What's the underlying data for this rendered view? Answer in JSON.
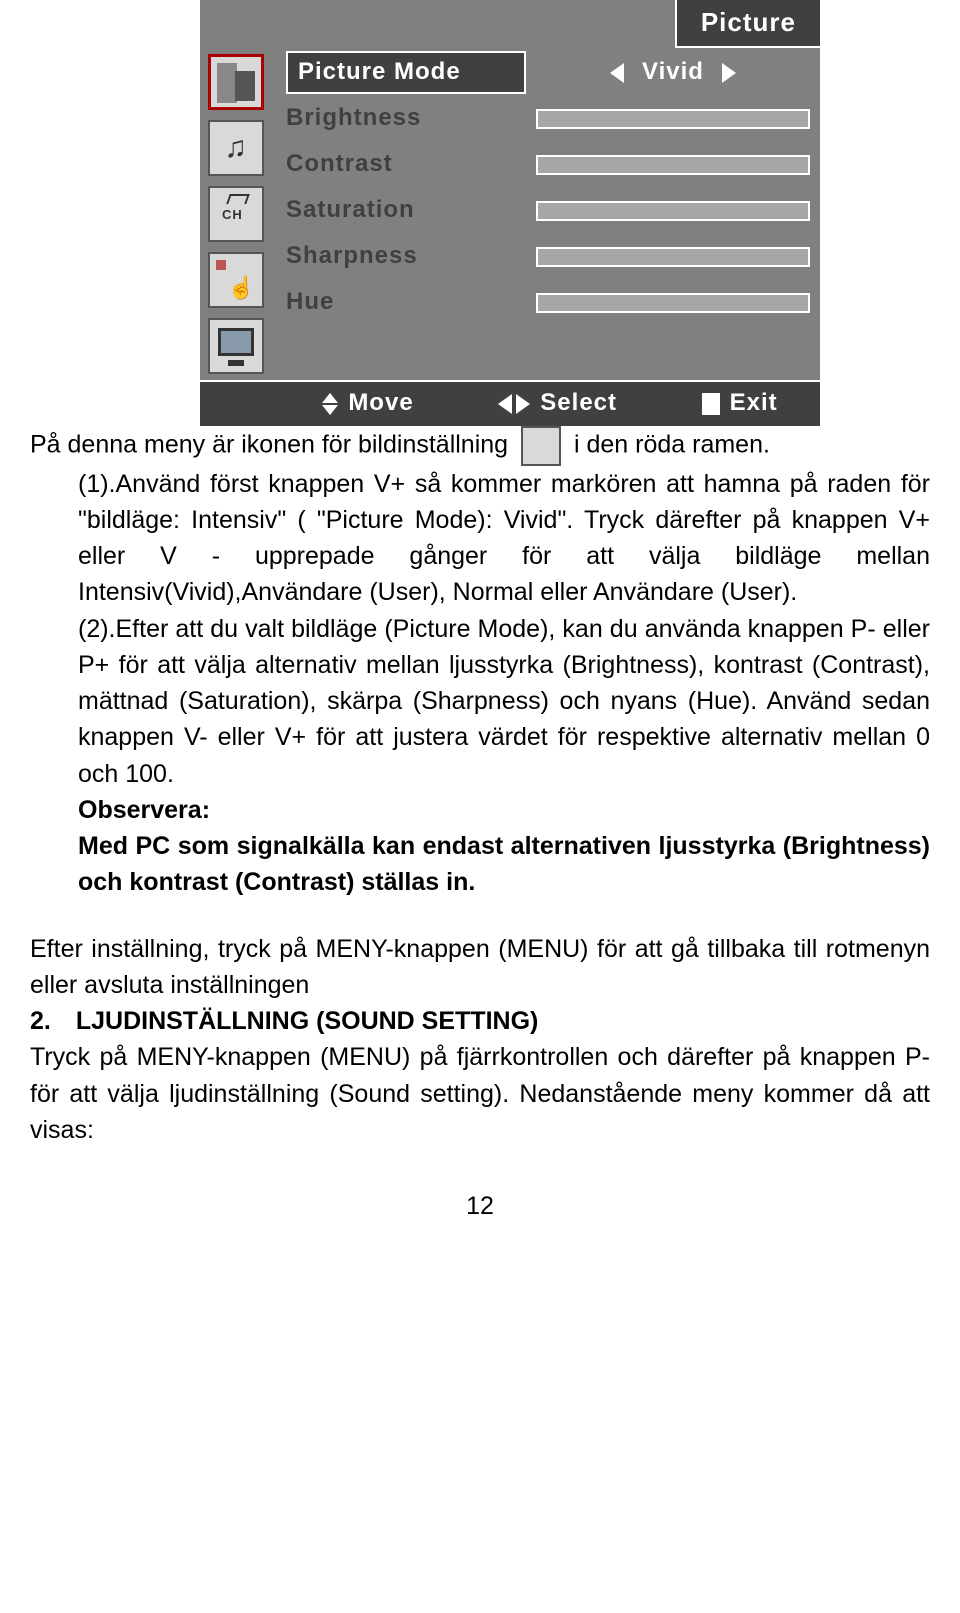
{
  "osd": {
    "title": "Picture",
    "rows": [
      {
        "label": "Picture Mode",
        "value": "Vivid",
        "type": "select",
        "active": true
      },
      {
        "label": "Brightness",
        "type": "bar"
      },
      {
        "label": "Contrast",
        "type": "bar"
      },
      {
        "label": "Saturation",
        "type": "bar"
      },
      {
        "label": "Sharpness",
        "type": "bar"
      },
      {
        "label": "Hue",
        "type": "bar"
      }
    ],
    "footer": {
      "move": "Move",
      "select": "Select",
      "exit": "Exit"
    }
  },
  "text": {
    "line1a": "På denna meny är ikonen för bildinställning",
    "line1b": "i den röda ramen.",
    "p1": "(1).Använd först knappen V+ så kommer markören att hamna på raden för \"bildläge: Intensiv\" ( \"Picture Mode): Vivid\". Tryck därefter på knappen V+ eller V - upprepade gånger för att välja bildläge mellan Intensiv(Vivid),Användare (User), Normal eller Användare (User).",
    "p2": "(2).Efter att du valt bildläge (Picture Mode), kan du använda knappen P- eller P+ för att välja alternativ mellan ljusstyrka (Brightness), kontrast (Contrast), mättnad (Saturation), skärpa (Sharpness) och nyans (Hue). Använd sedan knappen V- eller V+ för att justera värdet för respektive alternativ mellan 0 och 100.",
    "obs_h": "Observera:",
    "obs_b": "Med PC som signalkälla kan endast alternativen ljusstyrka (Brightness) och kontrast (Contrast) ställas in.",
    "p3": "Efter inställning, tryck på MENY-knappen (MENU) för att gå tillbaka till rotmenyn eller avsluta inställningen",
    "sec2_h": "2. LJUDINSTÄLLNING (SOUND SETTING)",
    "sec2_b": "Tryck på MENY-knappen (MENU) på fjärrkontrollen och därefter på knappen P- för att välja ljudinställning (Sound setting). Nedanstående meny kommer då att visas:",
    "page": "12"
  }
}
